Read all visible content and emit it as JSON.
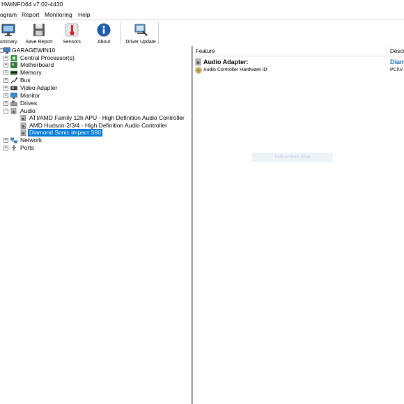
{
  "window": {
    "title": "HWiNFO64 v7.02-4430"
  },
  "menu": [
    "ogram",
    "Report",
    "Monitoring",
    "Help"
  ],
  "toolbar": {
    "items": [
      {
        "label": "ummary",
        "icon": "monitor-icon"
      },
      {
        "label": "Save Report",
        "icon": "floppy-icon"
      },
      {
        "label": "Sensors",
        "icon": "thermometer-icon"
      },
      {
        "label": "About",
        "icon": "info-icon"
      },
      {
        "label": "Driver Update",
        "icon": "driver-update-icon"
      }
    ]
  },
  "tree": {
    "root": "GARAGEWIN10",
    "nodes": [
      {
        "label": "Central Processor(s)",
        "icon": "cpu-icon",
        "expander": "+"
      },
      {
        "label": "Motherboard",
        "icon": "motherboard-icon",
        "expander": "+"
      },
      {
        "label": "Memory",
        "icon": "memory-icon",
        "expander": "+"
      },
      {
        "label": "Bus",
        "icon": "bus-icon",
        "expander": "+"
      },
      {
        "label": "Video Adapter",
        "icon": "video-adapter-icon",
        "expander": "+"
      },
      {
        "label": "Monitor",
        "icon": "monitor-icon",
        "expander": "+"
      },
      {
        "label": "Drives",
        "icon": "drive-icon",
        "expander": "+"
      },
      {
        "label": "Audio",
        "icon": "speaker-icon",
        "expander": "-"
      },
      {
        "label": "ATI/AMD Family 12h APU - High Definition Audio Controller",
        "icon": "speaker-icon"
      },
      {
        "label": "AMD Hudson-2/3/4 - High Definition Audio Controller",
        "icon": "speaker-icon"
      },
      {
        "label": "Diamond Sonic Impact S90",
        "icon": "speaker-icon",
        "selected": true
      },
      {
        "label": "Network",
        "icon": "network-icon",
        "expander": "+"
      },
      {
        "label": "Ports",
        "icon": "ports-icon",
        "expander": "+"
      }
    ]
  },
  "details": {
    "columns": [
      "Feature",
      "Descr"
    ],
    "section_title": "Audio Adapter:",
    "section_value": "Diam",
    "rows": [
      {
        "feature": "Audio Controller Hardware ID:",
        "value": "PCI\\V"
      }
    ]
  },
  "watermark": "Full-screen Snip",
  "colors": {
    "selection": "#0078d7",
    "link_blue": "#1a6cc2"
  }
}
